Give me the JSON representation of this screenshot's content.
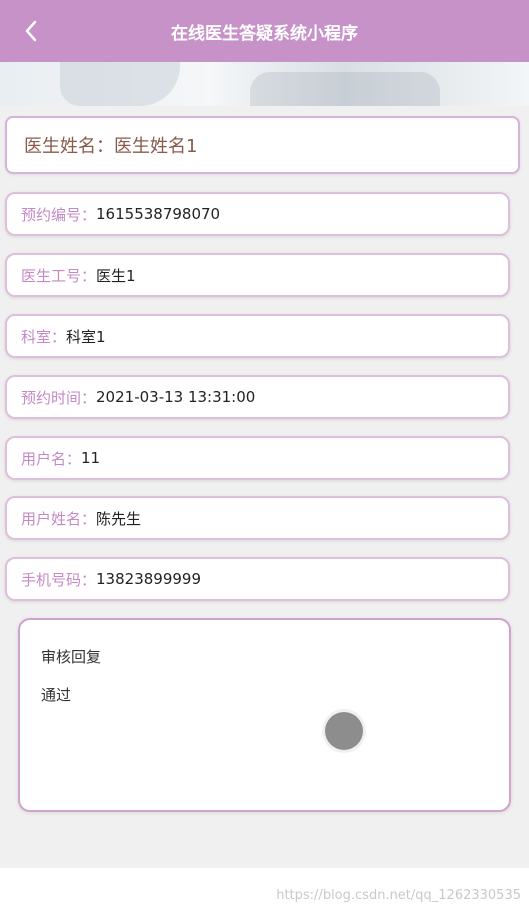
{
  "header": {
    "title": "在线医生答疑系统小程序"
  },
  "doctor_name": {
    "label": "医生姓名：",
    "value": "医生姓名1"
  },
  "fields": [
    {
      "label": "预约编号：",
      "value": "1615538798070"
    },
    {
      "label": "医生工号：",
      "value": "医生1"
    },
    {
      "label": "科室：",
      "value": "科室1"
    },
    {
      "label": "预约时间：",
      "value": "2021-03-13 13:31:00"
    },
    {
      "label": "用户名：",
      "value": "11"
    },
    {
      "label": "用户姓名：",
      "value": "陈先生"
    },
    {
      "label": "手机号码：",
      "value": "13823899999"
    }
  ],
  "reply": {
    "label": "审核回复",
    "value": "通过"
  },
  "watermark": "https://blog.csdn.net/qq_1262330535",
  "colors": {
    "accent": "#c792c8",
    "label": "#c58ac6",
    "border": "#dcc0dc"
  }
}
